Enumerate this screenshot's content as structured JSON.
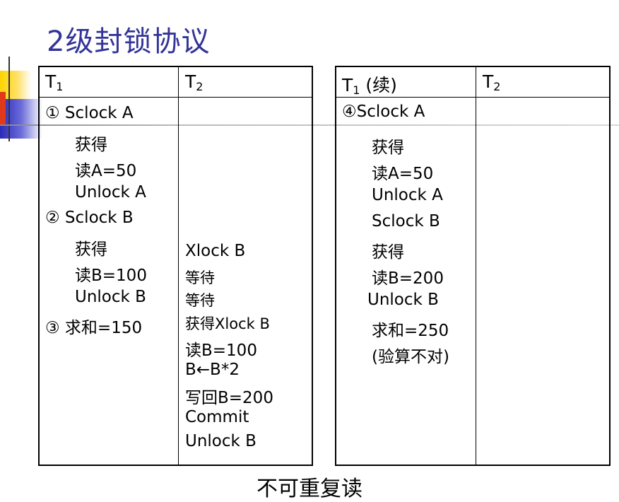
{
  "slide": {
    "title": "2级封锁协议",
    "caption": "不可重复读"
  },
  "left_table": {
    "header_t1": "T",
    "header_t1_sub": "1",
    "header_t2": "T",
    "header_t2_sub": "2",
    "t1_lines": [
      "① Sclock A",
      "获得",
      "读A=50",
      "Unlock A",
      "② Sclock B",
      "获得",
      "读B=100",
      "Unlock  B",
      "③ 求和=150"
    ],
    "t2_lines": [
      "Xlock B",
      "等待",
      "等待",
      "获得Xlock B",
      "读B=100",
      "B←B*2",
      "写回B=200",
      "Commit",
      "Unlock B"
    ]
  },
  "right_table": {
    "header_t1": "T",
    "header_t1_sub": "1",
    "header_t1_suffix": " (续)",
    "header_t2": "T",
    "header_t2_sub": "2",
    "t1_lines": [
      "④Sclock A",
      "获得",
      "读A=50",
      "Unlock A",
      "Sclock B",
      "获得",
      "读B=200",
      "Unlock  B",
      "求和=250",
      "(验算不对)"
    ]
  }
}
